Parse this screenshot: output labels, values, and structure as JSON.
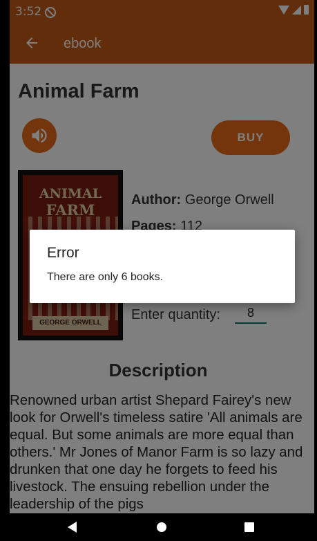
{
  "status": {
    "time": "3:52"
  },
  "appbar": {
    "title": "ebook"
  },
  "book": {
    "title": "Animal Farm",
    "buy_label": "BUY",
    "author_label": "Author:",
    "author": "George Orwell",
    "pages_label": "Pages:",
    "pages": "112",
    "quantity_label": "Enter quantity:",
    "quantity_value": "8",
    "cover_title_line1": "ANIMAL",
    "cover_title_line2": "FARM",
    "cover_author": "GEORGE ORWELL"
  },
  "description": {
    "heading": "Description",
    "text": "Renowned urban artist Shepard Fairey's new look for Orwell's timeless satire 'All animals are equal. But some animals are more equal than others.' Mr Jones of Manor Farm is so lazy and drunken that one day he forgets to feed his livestock. The ensuing rebellion under the leadership of the pigs"
  },
  "dialog": {
    "title": "Error",
    "message": "There are only 6 books."
  },
  "colors": {
    "primary": "#c35a14",
    "accent": "#e86a1a",
    "input_underline": "#0a7a6a"
  }
}
